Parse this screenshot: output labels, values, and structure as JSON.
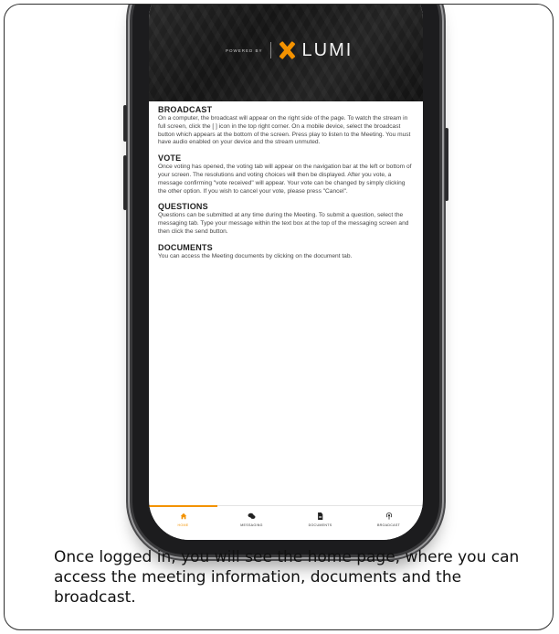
{
  "banner": {
    "powered_by": "POWERED BY",
    "brand": "LUMI",
    "brand_color": "#f39200"
  },
  "sections": [
    {
      "title": "BROADCAST",
      "text": "On a computer, the broadcast will appear on the right side of the page. To watch the stream in full screen, click the [ ] icon in the top right corner. On a mobile device, select the broadcast button which appears at the bottom of the screen. Press play to listen to the Meeting. You must have audio enabled on your device and the stream unmuted."
    },
    {
      "title": "VOTE",
      "text": "Once voting has opened, the voting tab will appear on the navigation bar at the left or bottom of your screen. The resolutions and voting choices will then be displayed. After you vote, a message confirming \"vote received\" will appear. Your vote can be changed by simply clicking the other option. If you wish to cancel your vote, please press \"Cancel\"."
    },
    {
      "title": "QUESTIONS",
      "text": "Questions can be submitted at any time during the Meeting. To submit a question, select the messaging tab. Type your message within the text box at the top of the messaging screen and then click the send button."
    },
    {
      "title": "DOCUMENTS",
      "text": "You can access the Meeting documents by clicking on the document tab."
    }
  ],
  "tabs": [
    {
      "label": "HOME",
      "icon": "home-icon",
      "active": true
    },
    {
      "label": "MESSAGING",
      "icon": "chat-icon",
      "active": false
    },
    {
      "label": "DOCUMENTS",
      "icon": "document-icon",
      "active": false
    },
    {
      "label": "BROADCAST",
      "icon": "broadcast-icon",
      "active": false
    }
  ],
  "caption": "Once logged in, you will see the home page, where you can access the meeting information, documents and the broadcast."
}
